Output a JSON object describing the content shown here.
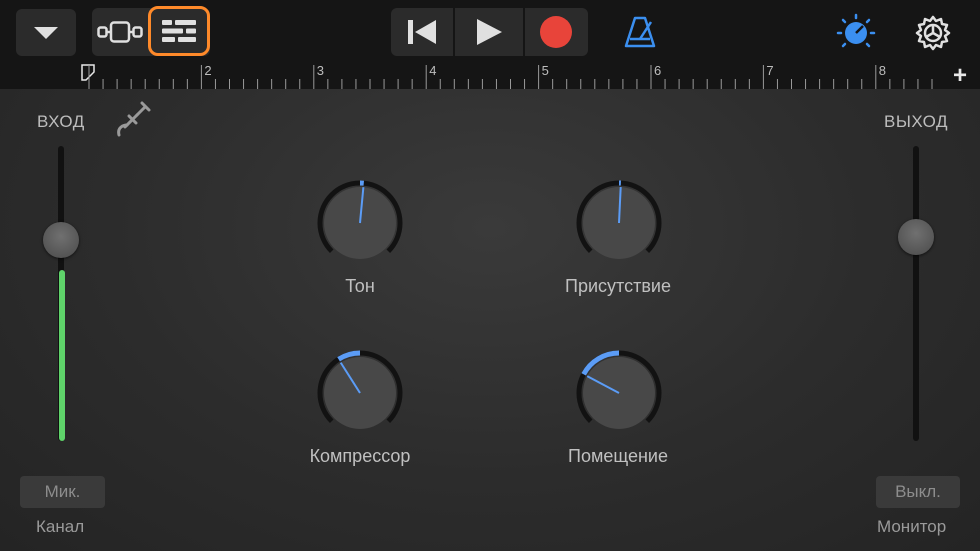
{
  "toolbar": {
    "menu_icon": "chevron-down-icon",
    "tracks_view_icon": "tracks-view-icon",
    "mixer_view_icon": "mixer-view-icon",
    "rewind_icon": "go-to-beginning-icon",
    "play_icon": "play-icon",
    "record_icon": "record-icon",
    "metronome_icon": "metronome-icon",
    "master_knob_icon": "master-effects-knob-icon",
    "settings_icon": "gear-icon",
    "accent_color": "#ff8a2a",
    "record_color": "#e8443a",
    "metronome_color": "#3b8ff0"
  },
  "ruler": {
    "marks": [
      "2",
      "3",
      "4",
      "5",
      "6",
      "7",
      "8"
    ],
    "add_label": "+"
  },
  "input": {
    "label": "ВХОД",
    "level": 0.58,
    "slider": 0.32,
    "channel_button": "Мик.",
    "channel_label": "Канал",
    "cable_icon": "input-jack-icon",
    "meter_color": "#5fd36a"
  },
  "output": {
    "label": "ВЫХОД",
    "slider": 0.31,
    "monitor_button": "Выкл.",
    "monitor_label": "Монитор"
  },
  "knobs": [
    {
      "label": "Тон",
      "value": 0.52
    },
    {
      "label": "Присутствие",
      "value": 0.51
    },
    {
      "label": "Компрессор",
      "value": 0.38
    },
    {
      "label": "Помещение",
      "value": 0.27
    }
  ],
  "knob_accent": "#5b9cf6"
}
